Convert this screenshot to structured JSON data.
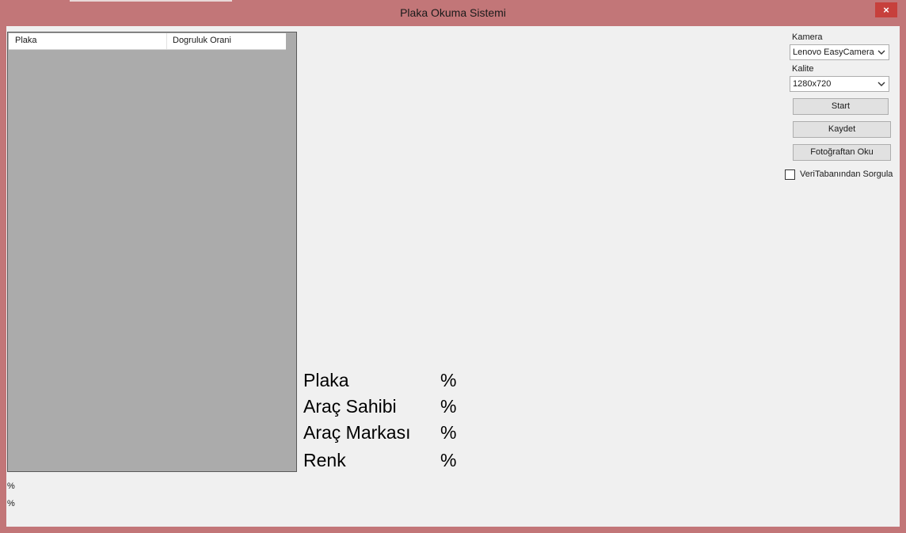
{
  "window": {
    "title": "Plaka Okuma Sistemi",
    "close_glyph": "×"
  },
  "listview": {
    "columns": [
      "Plaka",
      "Dogruluk Orani"
    ]
  },
  "bottom_labels": [
    "%",
    "%"
  ],
  "info": [
    {
      "label": "Plaka",
      "pct": "%"
    },
    {
      "label": "Araç Sahibi",
      "pct": "%"
    },
    {
      "label": "Araç Markası",
      "pct": "%"
    },
    {
      "label": "Renk",
      "pct": "%"
    }
  ],
  "controls": {
    "camera_label": "Kamera",
    "camera_value": "Lenovo EasyCamera",
    "quality_label": "Kalite",
    "quality_value": "1280x720",
    "start_label": "Start",
    "save_label": "Kaydet",
    "read_photo_label": "Fotoğraftan Oku",
    "db_query_label": "VeriTabanından Sorgula"
  },
  "colors": {
    "title_bar": "#c27678",
    "close_button": "#c7403c",
    "client_bg": "#f0f0f0",
    "listview_bg": "#ababab"
  },
  "icons": {
    "close": "close-icon",
    "dropdown": "chevron-down-icon"
  }
}
